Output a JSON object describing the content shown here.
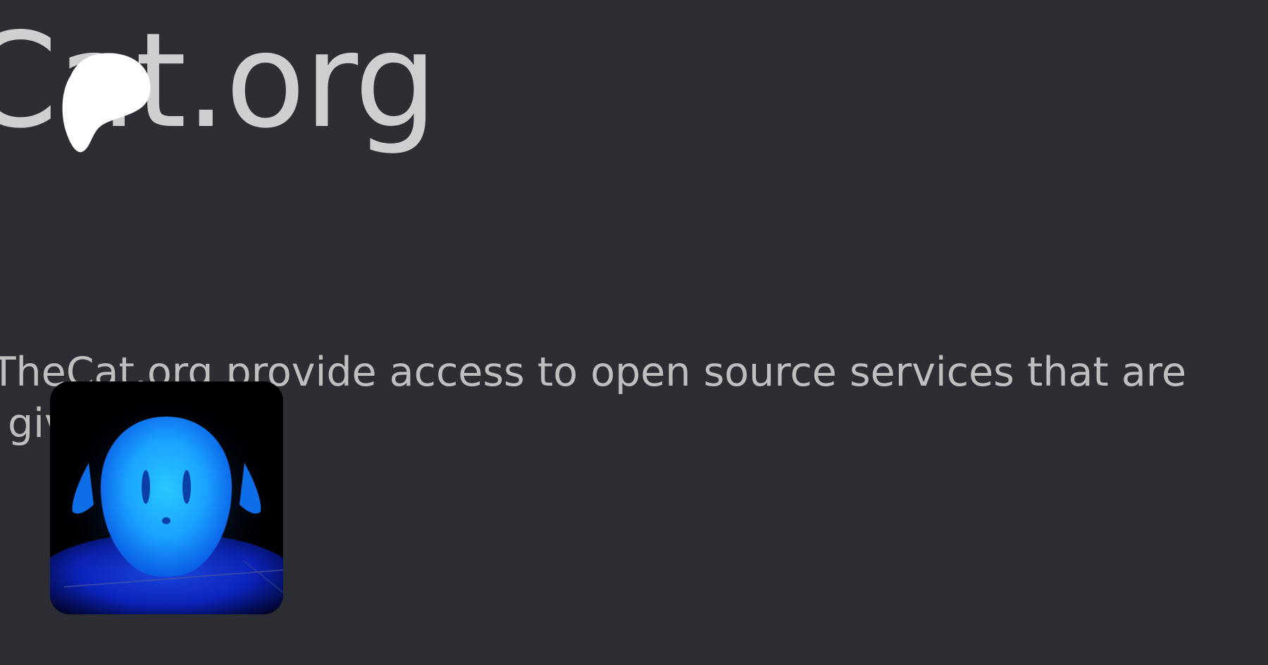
{
  "header": {
    "title": "Cat.org"
  },
  "intro": {
    "line1": "sTheCat.org provide access to open source services that are",
    "line2": "o give to users."
  },
  "avatar": {
    "icon": "glowing-blue-ghost-lamp-icon",
    "glow_color": "#1a7cff"
  },
  "overlay": {
    "icon": "white-blob-icon"
  },
  "colors": {
    "background": "#2c2e33",
    "title_text": "#cfcfcf",
    "body_text": "#bfbfbf"
  }
}
